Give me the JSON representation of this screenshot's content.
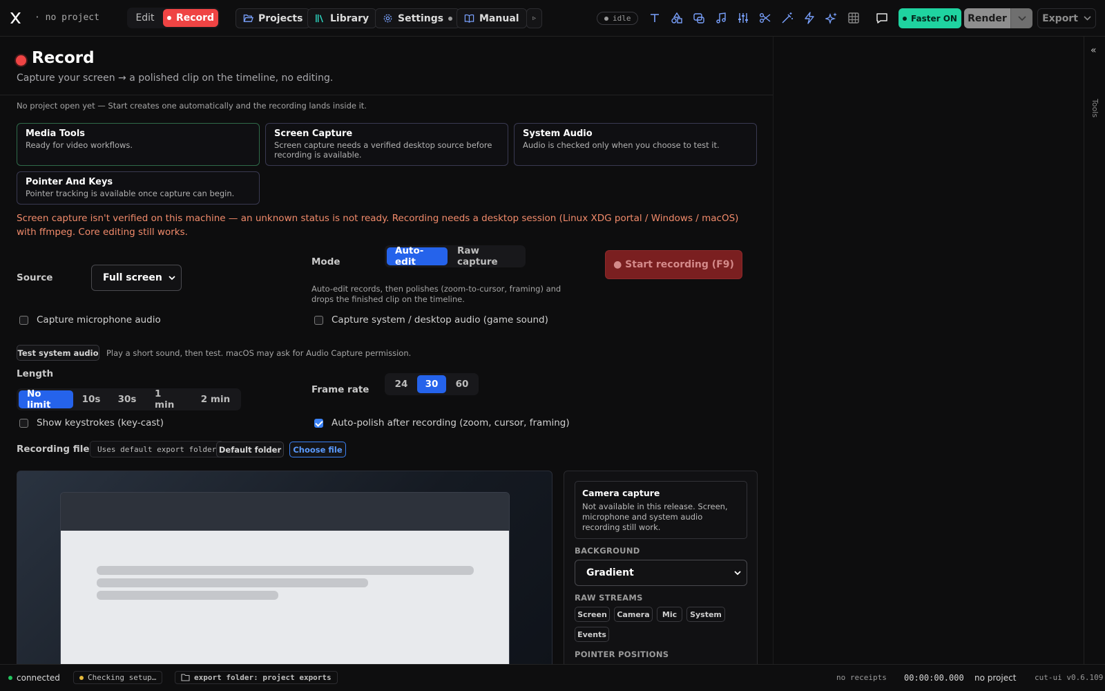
{
  "topbar": {
    "project": "· no project",
    "mode_edit": "Edit",
    "mode_record": "Record",
    "nav": [
      {
        "label": "Projects",
        "icon": "folder-icon"
      },
      {
        "label": "Library",
        "icon": "library-icon"
      },
      {
        "label": "Settings",
        "icon": "gear-icon"
      },
      {
        "label": "Manual",
        "icon": "book-icon"
      }
    ],
    "small_btn": "▹",
    "state": "idle",
    "tools": [
      "text-icon",
      "shapes-icon",
      "overlay-icon",
      "music-icon",
      "sliders-icon",
      "scissors-icon",
      "magic-wand-icon",
      "lightning-icon",
      "sparkles-icon",
      "grid-icon",
      "comment-icon"
    ],
    "faster": "Faster ON",
    "render": "Render",
    "export": "Export"
  },
  "rail": {
    "label": "Tools"
  },
  "page": {
    "title": "Record",
    "subtitle": "Capture your screen → a polished clip on the timeline, no editing.",
    "note": "No project open yet — Start creates one automatically and the recording lands inside it."
  },
  "cards": [
    {
      "title": "Media Tools",
      "desc": "Ready for video workflows."
    },
    {
      "title": "Screen Capture",
      "desc": "Screen capture needs a verified desktop source before recording is available."
    },
    {
      "title": "System Audio",
      "desc": "Audio is checked only when you choose to test it."
    },
    {
      "title": "Pointer And Keys",
      "desc": "Pointer tracking is available once capture can begin."
    }
  ],
  "warning": "Screen capture isn't verified on this machine — an unknown status is not ready. Recording needs a desktop session (Linux XDG portal / Windows / macOS) with ffmpeg. Core editing still works.",
  "form": {
    "source_label": "Source",
    "source_value": "Full screen",
    "mode_label": "Mode",
    "mode_options": [
      "Auto-edit",
      "Raw capture"
    ],
    "mode_selected": "Auto-edit",
    "mode_hint": "Auto-edit records, then polishes (zoom-to-cursor, framing) and drops the finished clip on the timeline.",
    "start": "● Start recording (F9)",
    "mic": "Capture microphone audio",
    "sysaudio": "Capture system / desktop audio (game sound)",
    "test_btn": "Test system audio",
    "test_hint": "Play a short sound, then test. macOS may ask for Audio Capture permission.",
    "length_label": "Length",
    "length_options": [
      "No limit",
      "10s",
      "30s",
      "1 min",
      "2 min"
    ],
    "length_selected": "No limit",
    "fps_label": "Frame rate",
    "fps_options": [
      "24",
      "30",
      "60"
    ],
    "fps_selected": "30",
    "keystrokes": "Show keystrokes (key-cast)",
    "keystrokes_checked": false,
    "autopolish": "Auto-polish after recording (zoom, cursor, framing)",
    "autopolish_checked": true,
    "file_label": "Recording file",
    "file_path": "Uses default export folder",
    "default_folder": "Default folder",
    "choose_file": "Choose file"
  },
  "side": {
    "cam_title": "Camera capture",
    "cam_desc": "Not available in this release. Screen, microphone and system audio recording still work.",
    "bg_label": "BACKGROUND",
    "bg_value": "Gradient",
    "raw_label": "RAW STREAMS",
    "streams": [
      "Screen",
      "Camera",
      "Mic",
      "System",
      "Events"
    ],
    "pointer_label": "POINTER POSITIONS"
  },
  "status": {
    "conn": "connected",
    "setup": "Checking setup…",
    "folder": "export folder: project exports",
    "receipts": "no receipts",
    "time": "00:00:00.000",
    "project": "no project",
    "version": "cut-ui v0.6.109"
  }
}
